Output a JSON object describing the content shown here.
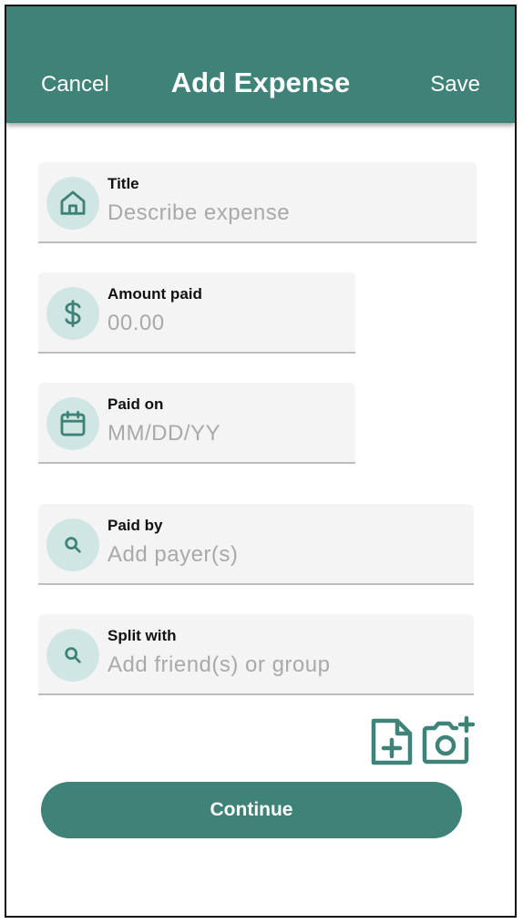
{
  "header": {
    "cancel_label": "Cancel",
    "title": "Add Expense",
    "save_label": "Save"
  },
  "fields": [
    {
      "label": "Title",
      "placeholder": "Describe expense",
      "icon": "home-icon"
    },
    {
      "label": "Amount paid",
      "placeholder": "00.00",
      "icon": "dollar-icon"
    },
    {
      "label": "Paid on",
      "placeholder": "MM/DD/YY",
      "icon": "calendar-icon"
    },
    {
      "label": "Paid by",
      "placeholder": "Add payer(s)",
      "icon": "search-icon"
    },
    {
      "label": "Split with",
      "placeholder": "Add friend(s) or group",
      "icon": "search-icon"
    }
  ],
  "attachments": {
    "add_file_icon": "file-plus-icon",
    "add_photo_icon": "camera-plus-icon"
  },
  "continue_label": "Continue",
  "colors": {
    "primary": "#3f8378",
    "icon_bg": "#cfe6e2",
    "field_bg": "#f4f4f4"
  }
}
